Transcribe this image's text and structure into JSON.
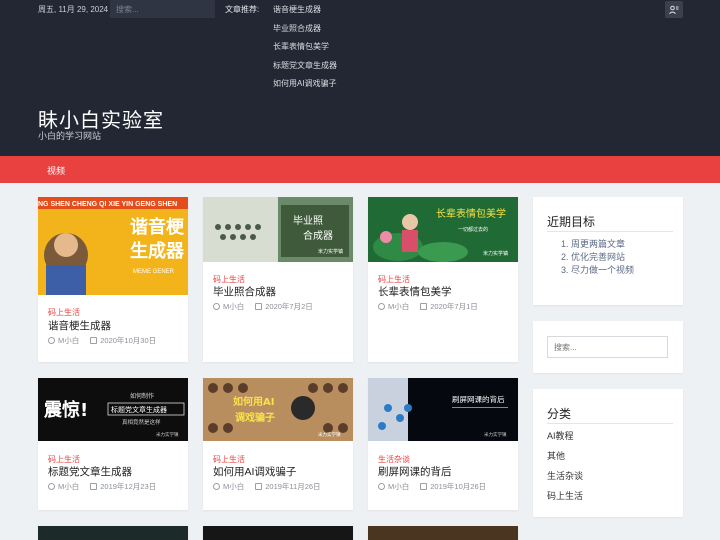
{
  "topbar": {
    "date": "周五, 11月 29, 2024",
    "search_placeholder": "搜索...",
    "recommend_label": "文章推荐:",
    "recommend_items": [
      "谐音梗生成器",
      "毕业照合成器",
      "长辈表情包美学",
      "标题党文章生成器",
      "如何用AI调戏骗子"
    ],
    "user_icon": "user-switch-icon"
  },
  "header": {
    "title": "眛小白实验室",
    "description": "小白的学习网站"
  },
  "nav": {
    "items": [
      "视频"
    ]
  },
  "posts": [
    {
      "category": "码上生活",
      "title": "谐音梗生成器",
      "author": "M小白",
      "date": "2020年10月30日",
      "thumb_text": "谐音梗生成器",
      "thumb_color": "#f1b51c"
    },
    {
      "category": "码上生活",
      "title": "毕业照合成器",
      "author": "M小白",
      "date": "2020年7月2日",
      "thumb_text": "毕业照合成器",
      "thumb_color": "#4e6a4a"
    },
    {
      "category": "码上生活",
      "title": "长辈表情包美学",
      "author": "M小白",
      "date": "2020年7月1日",
      "thumb_text": "长辈表情包美学",
      "thumb_color": "#2d6a3a"
    },
    {
      "category": "码上生活",
      "title": "标题党文章生成器",
      "author": "M小白",
      "date": "2019年12月23日",
      "thumb_text": "震惊！标题党文章生成器",
      "thumb_color": "#111111"
    },
    {
      "category": "码上生活",
      "title": "如何用AI调戏骗子",
      "author": "M小白",
      "date": "2019年11月26日",
      "thumb_text": "如何用AI调戏骗子",
      "thumb_color": "#c9a06b"
    },
    {
      "category": "生活杂谈",
      "title": "刷屏网课的背后",
      "author": "M小白",
      "date": "2019年10月26日",
      "thumb_text": "刷屏网课的背后",
      "thumb_color": "#0a0f1a"
    }
  ],
  "sidebar": {
    "recent": {
      "title": "近期目标",
      "items": [
        "1. 周更两篇文章",
        "2. 优化完善网站",
        "3. 尽力做一个视频"
      ]
    },
    "search": {
      "placeholder": "搜索..."
    },
    "categories": {
      "title": "分类",
      "items": [
        "AI教程",
        "其他",
        "生活杂谈",
        "码上生活"
      ]
    }
  }
}
